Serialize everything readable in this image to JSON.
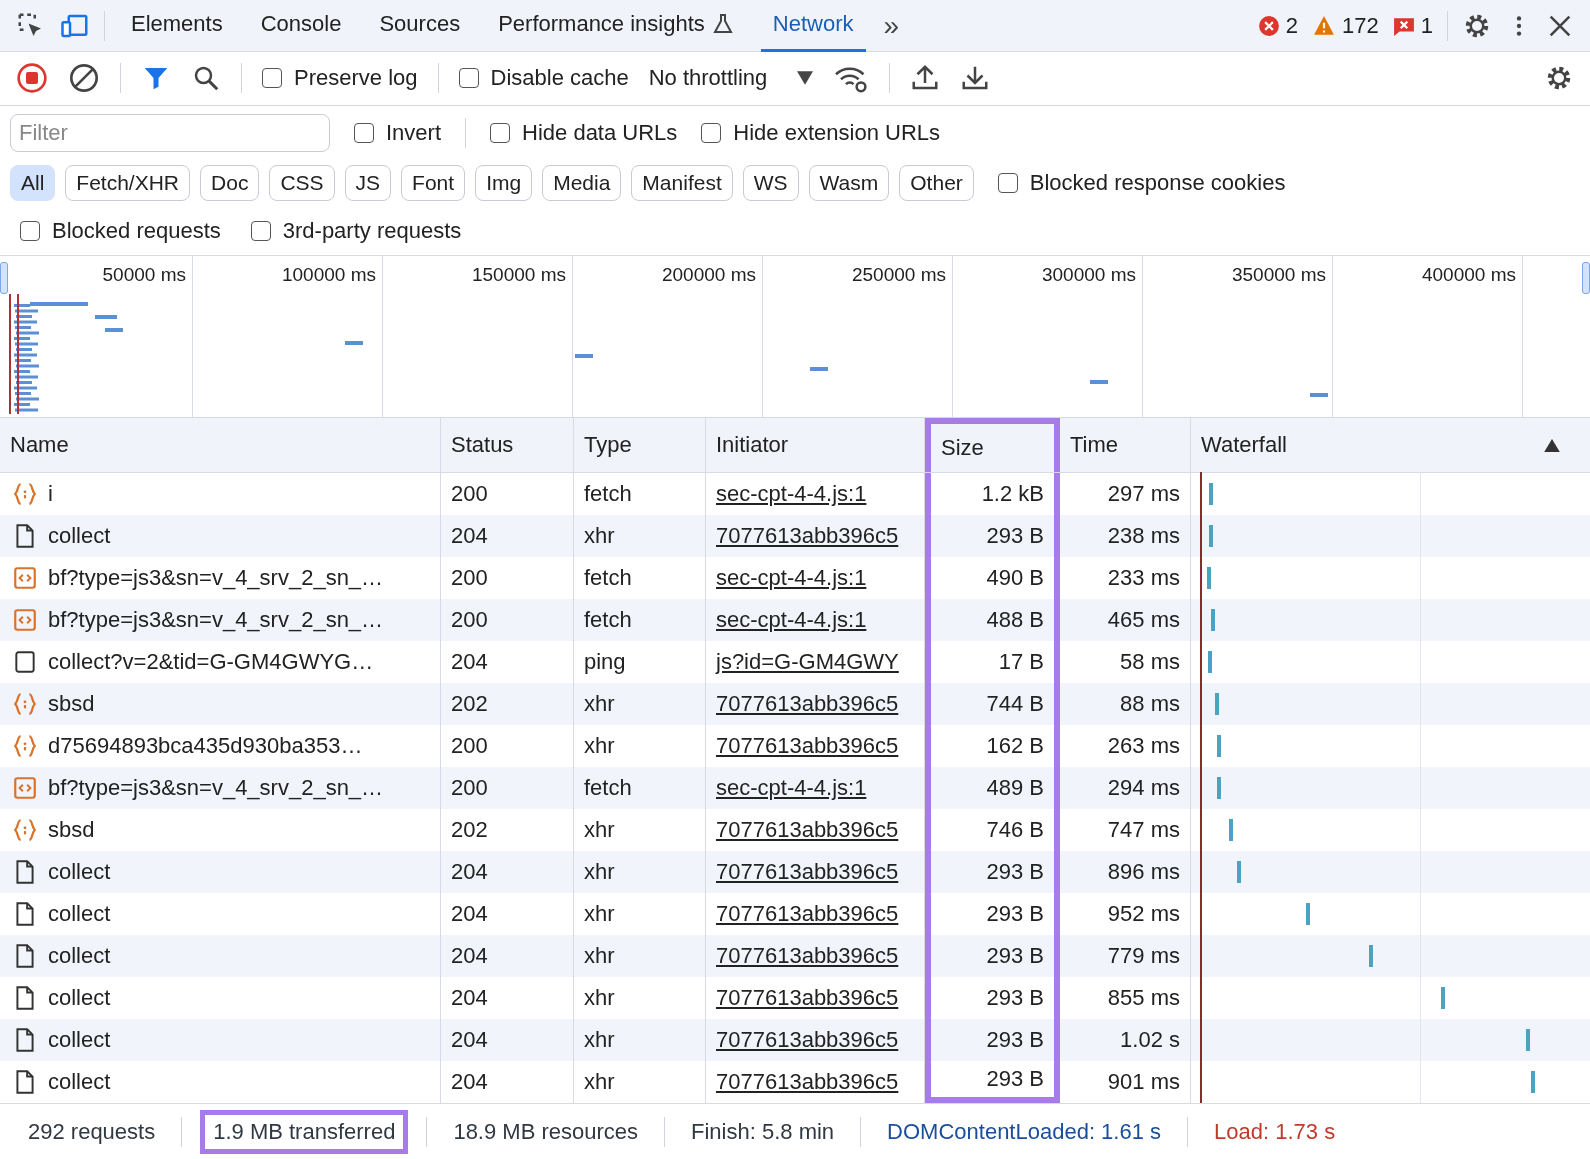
{
  "tabs": [
    {
      "label": "Elements",
      "selected": false,
      "flask": false
    },
    {
      "label": "Console",
      "selected": false,
      "flask": false
    },
    {
      "label": "Sources",
      "selected": false,
      "flask": false
    },
    {
      "label": "Performance insights",
      "selected": false,
      "flask": true
    },
    {
      "label": "Network",
      "selected": true,
      "flask": false
    }
  ],
  "more_tabs": "»",
  "counters": [
    {
      "kind": "error",
      "count": "2"
    },
    {
      "kind": "warning",
      "count": "172"
    },
    {
      "kind": "issue",
      "count": "1"
    }
  ],
  "toolbar": {
    "recording": true,
    "preserve_log": {
      "label": "Preserve log",
      "checked": false
    },
    "disable_cache": {
      "label": "Disable cache",
      "checked": false
    },
    "throttling": "No throttling"
  },
  "filter": {
    "placeholder": "Filter",
    "options": [
      {
        "label": "Invert",
        "checked": false
      },
      {
        "label": "Hide data URLs",
        "checked": false
      },
      {
        "label": "Hide extension URLs",
        "checked": false
      }
    ]
  },
  "type_filters": [
    {
      "label": "All",
      "selected": true
    },
    {
      "label": "Fetch/XHR",
      "selected": false
    },
    {
      "label": "Doc",
      "selected": false
    },
    {
      "label": "CSS",
      "selected": false
    },
    {
      "label": "JS",
      "selected": false
    },
    {
      "label": "Font",
      "selected": false
    },
    {
      "label": "Img",
      "selected": false
    },
    {
      "label": "Media",
      "selected": false
    },
    {
      "label": "Manifest",
      "selected": false
    },
    {
      "label": "WS",
      "selected": false
    },
    {
      "label": "Wasm",
      "selected": false
    },
    {
      "label": "Other",
      "selected": false
    }
  ],
  "blocked_cookies": {
    "label": "Blocked response cookies",
    "checked": false
  },
  "extra_options": [
    {
      "label": "Blocked requests",
      "checked": false
    },
    {
      "label": "3rd-party requests",
      "checked": false
    }
  ],
  "overview_ticks": [
    "50000 ms",
    "100000 ms",
    "150000 ms",
    "200000 ms",
    "250000 ms",
    "300000 ms",
    "350000 ms",
    "400000 ms"
  ],
  "table": {
    "columns": [
      {
        "label": "Name",
        "highlighted": false
      },
      {
        "label": "Status",
        "highlighted": false
      },
      {
        "label": "Type",
        "highlighted": false
      },
      {
        "label": "Initiator",
        "highlighted": false
      },
      {
        "label": "Size",
        "highlighted": true
      },
      {
        "label": "Time",
        "highlighted": false
      },
      {
        "label": "Waterfall",
        "highlighted": false
      }
    ],
    "rows": [
      {
        "kind": "json",
        "name": "i",
        "status": "200",
        "type": "fetch",
        "initiator": "sec-cpt-4-4.js:1",
        "size": "1.2 kB",
        "time": "297 ms"
      },
      {
        "kind": "document",
        "name": "collect",
        "status": "204",
        "type": "xhr",
        "initiator": "7077613abb396c5",
        "size": "293 B",
        "time": "238 ms"
      },
      {
        "kind": "script",
        "name": "bf?type=js3&sn=v_4_srv_2_sn_…",
        "status": "200",
        "type": "fetch",
        "initiator": "sec-cpt-4-4.js:1",
        "size": "490 B",
        "time": "233 ms"
      },
      {
        "kind": "script",
        "name": "bf?type=js3&sn=v_4_srv_2_sn_…",
        "status": "200",
        "type": "fetch",
        "initiator": "sec-cpt-4-4.js:1",
        "size": "488 B",
        "time": "465 ms"
      },
      {
        "kind": "other",
        "name": "collect?v=2&tid=G-GM4GWYG…",
        "status": "204",
        "type": "ping",
        "initiator": "js?id=G-GM4GWY",
        "size": "17 B",
        "time": "58 ms"
      },
      {
        "kind": "json",
        "name": "sbsd",
        "status": "202",
        "type": "xhr",
        "initiator": "7077613abb396c5",
        "size": "744 B",
        "time": "88 ms"
      },
      {
        "kind": "json",
        "name": "d75694893bca435d930ba353…",
        "status": "200",
        "type": "xhr",
        "initiator": "7077613abb396c5",
        "size": "162 B",
        "time": "263 ms"
      },
      {
        "kind": "script",
        "name": "bf?type=js3&sn=v_4_srv_2_sn_…",
        "status": "200",
        "type": "fetch",
        "initiator": "sec-cpt-4-4.js:1",
        "size": "489 B",
        "time": "294 ms"
      },
      {
        "kind": "json",
        "name": "sbsd",
        "status": "202",
        "type": "xhr",
        "initiator": "7077613abb396c5",
        "size": "746 B",
        "time": "747 ms"
      },
      {
        "kind": "document",
        "name": "collect",
        "status": "204",
        "type": "xhr",
        "initiator": "7077613abb396c5",
        "size": "293 B",
        "time": "896 ms"
      },
      {
        "kind": "document",
        "name": "collect",
        "status": "204",
        "type": "xhr",
        "initiator": "7077613abb396c5",
        "size": "293 B",
        "time": "952 ms"
      },
      {
        "kind": "document",
        "name": "collect",
        "status": "204",
        "type": "xhr",
        "initiator": "7077613abb396c5",
        "size": "293 B",
        "time": "779 ms"
      },
      {
        "kind": "document",
        "name": "collect",
        "status": "204",
        "type": "xhr",
        "initiator": "7077613abb396c5",
        "size": "293 B",
        "time": "855 ms"
      },
      {
        "kind": "document",
        "name": "collect",
        "status": "204",
        "type": "xhr",
        "initiator": "7077613abb396c5",
        "size": "293 B",
        "time": "1.02 s"
      },
      {
        "kind": "document",
        "name": "collect",
        "status": "204",
        "type": "xhr",
        "initiator": "7077613abb396c5",
        "size": "293 B",
        "time": "901 ms"
      }
    ]
  },
  "status_bar": [
    {
      "text": "292 requests",
      "color": "#303942",
      "highlighted": false
    },
    {
      "text": "1.9 MB transferred",
      "color": "#303942",
      "highlighted": true
    },
    {
      "text": "18.9 MB resources",
      "color": "#303942",
      "highlighted": false
    },
    {
      "text": "Finish: 5.8 min",
      "color": "#303942",
      "highlighted": false
    },
    {
      "text": "DOMContentLoaded: 1.61 s",
      "color": "#1a4e9c",
      "highlighted": false
    },
    {
      "text": "Load: 1.73 s",
      "color": "#c0392b",
      "highlighted": false
    }
  ]
}
